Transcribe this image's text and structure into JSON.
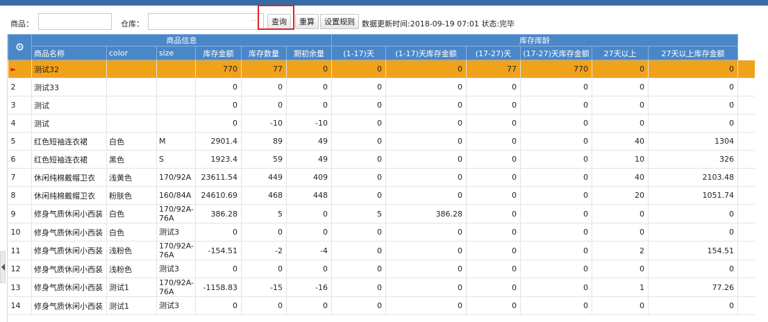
{
  "toolbar": {
    "product_label": "商品：",
    "product_value": "",
    "warehouse_label": "仓库：",
    "warehouse_value": "",
    "query_label": "查询",
    "recalc_label": "重算",
    "rules_label": "设置规则",
    "status_text": "数据更新时间:2018-09-19 07:01  状态:完毕"
  },
  "grid": {
    "settings_icon": "gear-icon",
    "group_headers": {
      "product_info": "商品信息",
      "stock_age": "库存库龄"
    },
    "columns": [
      "商品名称",
      "color",
      "size",
      "库存金额",
      "库存数量",
      "期初余量",
      "(1-17)天",
      "(1-17)天库存金额",
      "(17-27)天",
      "(17-27)天库存金额",
      "27天以上",
      "27天以上库存金额"
    ],
    "selected_marker": "►",
    "rows": [
      {
        "no": "",
        "name": "测试32",
        "color": "",
        "size": "",
        "amount": "770",
        "qty": "77",
        "initial": "0",
        "d1_17": "0",
        "d1_17_amt": "0",
        "d17_27": "77",
        "d17_27_amt": "770",
        "d27": "0",
        "d27_amt": "0"
      },
      {
        "no": "2",
        "name": "测试33",
        "color": "",
        "size": "",
        "amount": "0",
        "qty": "0",
        "initial": "0",
        "d1_17": "0",
        "d1_17_amt": "0",
        "d17_27": "0",
        "d17_27_amt": "0",
        "d27": "0",
        "d27_amt": "0"
      },
      {
        "no": "3",
        "name": "测试",
        "color": "",
        "size": "",
        "amount": "0",
        "qty": "0",
        "initial": "0",
        "d1_17": "0",
        "d1_17_amt": "0",
        "d17_27": "0",
        "d17_27_amt": "0",
        "d27": "0",
        "d27_amt": "0"
      },
      {
        "no": "4",
        "name": "测试",
        "color": "",
        "size": "",
        "amount": "0",
        "qty": "-10",
        "initial": "-10",
        "d1_17": "0",
        "d1_17_amt": "0",
        "d17_27": "0",
        "d17_27_amt": "0",
        "d27": "0",
        "d27_amt": "0"
      },
      {
        "no": "5",
        "name": "红色短袖连衣裙",
        "color": "白色",
        "size": "M",
        "amount": "2901.4",
        "qty": "89",
        "initial": "49",
        "d1_17": "0",
        "d1_17_amt": "0",
        "d17_27": "0",
        "d17_27_amt": "0",
        "d27": "40",
        "d27_amt": "1304"
      },
      {
        "no": "6",
        "name": "红色短袖连衣裙",
        "color": "黑色",
        "size": "S",
        "amount": "1923.4",
        "qty": "59",
        "initial": "49",
        "d1_17": "0",
        "d1_17_amt": "0",
        "d17_27": "0",
        "d17_27_amt": "0",
        "d27": "10",
        "d27_amt": "326"
      },
      {
        "no": "7",
        "name": "休闲纯棉戴帽卫衣",
        "color": "浅黄色",
        "size": "170/92A",
        "amount": "23611.54",
        "qty": "449",
        "initial": "409",
        "d1_17": "0",
        "d1_17_amt": "0",
        "d17_27": "0",
        "d17_27_amt": "0",
        "d27": "40",
        "d27_amt": "2103.48"
      },
      {
        "no": "8",
        "name": "休闲纯棉戴帽卫衣",
        "color": "粉肤色",
        "size": "160/84A",
        "amount": "24610.69",
        "qty": "468",
        "initial": "448",
        "d1_17": "0",
        "d1_17_amt": "0",
        "d17_27": "0",
        "d17_27_amt": "0",
        "d27": "20",
        "d27_amt": "1051.74"
      },
      {
        "no": "9",
        "name": "修身气质休闲小西装",
        "color": "白色",
        "size": "170/92A-76A",
        "amount": "386.28",
        "qty": "5",
        "initial": "0",
        "d1_17": "5",
        "d1_17_amt": "386.28",
        "d17_27": "0",
        "d17_27_amt": "0",
        "d27": "0",
        "d27_amt": "0"
      },
      {
        "no": "10",
        "name": "修身气质休闲小西装",
        "color": "白色",
        "size": "测试3",
        "amount": "0",
        "qty": "0",
        "initial": "0",
        "d1_17": "0",
        "d1_17_amt": "0",
        "d17_27": "0",
        "d17_27_amt": "0",
        "d27": "0",
        "d27_amt": "0"
      },
      {
        "no": "11",
        "name": "修身气质休闲小西装",
        "color": "浅粉色",
        "size": "170/92A-76A",
        "amount": "-154.51",
        "qty": "-2",
        "initial": "-4",
        "d1_17": "0",
        "d1_17_amt": "0",
        "d17_27": "0",
        "d17_27_amt": "0",
        "d27": "2",
        "d27_amt": "154.51"
      },
      {
        "no": "12",
        "name": "修身气质休闲小西装",
        "color": "浅粉色",
        "size": "测试3",
        "amount": "0",
        "qty": "0",
        "initial": "0",
        "d1_17": "0",
        "d1_17_amt": "0",
        "d17_27": "0",
        "d17_27_amt": "0",
        "d27": "0",
        "d27_amt": "0"
      },
      {
        "no": "13",
        "name": "修身气质休闲小西装",
        "color": "测试1",
        "size": "170/92A-76A",
        "amount": "-1158.83",
        "qty": "-15",
        "initial": "-16",
        "d1_17": "0",
        "d1_17_amt": "0",
        "d17_27": "0",
        "d17_27_amt": "0",
        "d27": "1",
        "d27_amt": "77.26"
      },
      {
        "no": "14",
        "name": "修身气质休闲小西装",
        "color": "测试1",
        "size": "测试3",
        "amount": "0",
        "qty": "0",
        "initial": "0",
        "d1_17": "0",
        "d1_17_amt": "0",
        "d17_27": "0",
        "d17_27_amt": "0",
        "d27": "0",
        "d27_amt": "0"
      }
    ]
  }
}
